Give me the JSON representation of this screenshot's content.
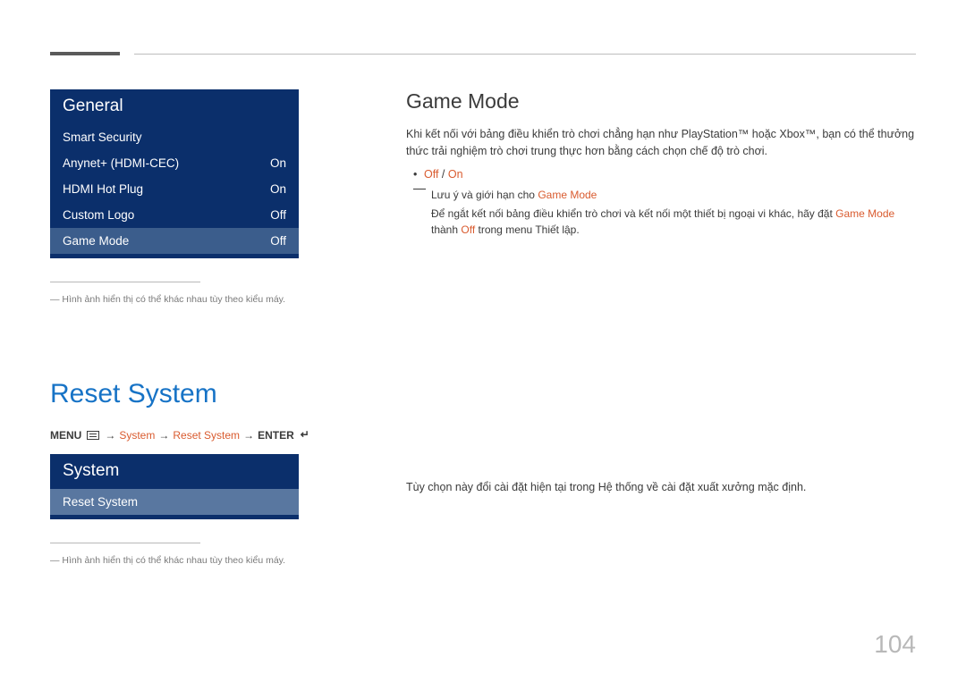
{
  "page_number": "104",
  "notes": {
    "img_vary": "― Hình ảnh hiển thị có thể khác nhau tùy theo kiểu máy."
  },
  "left": {
    "osd1": {
      "title": "General",
      "rows": [
        {
          "label": "Smart Security",
          "value": ""
        },
        {
          "label": "Anynet+ (HDMI-CEC)",
          "value": "On"
        },
        {
          "label": "HDMI Hot Plug",
          "value": "On"
        },
        {
          "label": "Custom Logo",
          "value": "Off"
        },
        {
          "label": "Game Mode",
          "value": "Off"
        }
      ]
    },
    "reset_heading": "Reset System",
    "path": {
      "menu": "MENU",
      "seg1": "System",
      "seg2": "Reset System",
      "enter": "ENTER"
    },
    "osd2": {
      "title": "System",
      "rows": [
        {
          "label": "Reset System",
          "value": ""
        }
      ]
    }
  },
  "right": {
    "game_mode": {
      "heading": "Game Mode",
      "p1": "Khi kết nối với bảng điều khiển trò chơi chẳng hạn như PlayStation™ hoặc Xbox™, bạn có thể thưởng thức trải nghiệm trò chơi trung thực hơn bằng cách chọn chế độ trò chơi.",
      "bullet_off": "Off",
      "bullet_sep": " / ",
      "bullet_on": "On",
      "note_lead": "Lưu ý và giới hạn cho ",
      "note_gm": "Game Mode",
      "note_body_a": "Để ngắt kết nối bảng điều khiển trò chơi và kết nối một thiết bị ngoại vi khác, hãy đặt ",
      "note_body_b": "Game Mode",
      "note_body_c": " thành ",
      "note_body_d": "Off",
      "note_body_e": " trong menu Thiết lập."
    },
    "reset_desc": "Tùy chọn này đổi cài đặt hiện tại trong Hệ thống về cài đặt xuất xưởng mặc định."
  }
}
